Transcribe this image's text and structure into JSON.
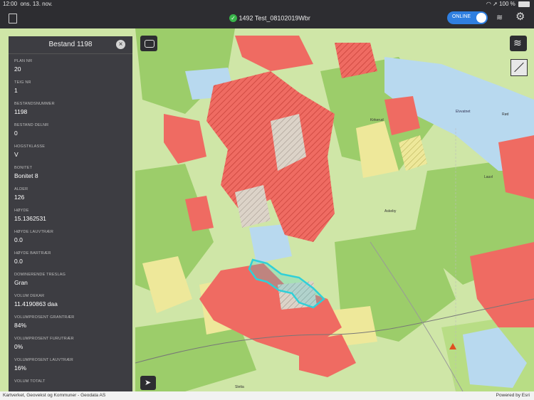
{
  "status_bar": {
    "time": "12:00",
    "date": "ons. 13. nov.",
    "battery": "100 %"
  },
  "top_bar": {
    "project_title": "1492 Test_08102019Wbr",
    "online_label": "ONLINE"
  },
  "panel": {
    "title": "Bestand 1198",
    "fields": [
      {
        "label": "PLAN NR",
        "value": "20"
      },
      {
        "label": "TEIG NR",
        "value": "1"
      },
      {
        "label": "BESTANDSNUMMER",
        "value": "1198"
      },
      {
        "label": "BESTAND DELNR",
        "value": "0"
      },
      {
        "label": "HOGSTKLASSE",
        "value": "V"
      },
      {
        "label": "BONITET",
        "value": "Bonitet 8"
      },
      {
        "label": "ALDER",
        "value": "126"
      },
      {
        "label": "HØYDE",
        "value": "15.1362531"
      },
      {
        "label": "HØYDE LAUVTRÆR",
        "value": "0.0"
      },
      {
        "label": "HØYDE BARTRÆR",
        "value": "0.0"
      },
      {
        "label": "DOMINERENDE TRESLAG",
        "value": "Gran"
      },
      {
        "label": "VOLUM DEKAR",
        "value": "11.4190863 daa"
      },
      {
        "label": "VOLUMPROSENT GRANTRÆR",
        "value": "84%"
      },
      {
        "label": "VOLUMPROSENT FURUTRÆR",
        "value": "0%"
      },
      {
        "label": "VOLUMPROSENT LAUVTRÆR",
        "value": "16%"
      },
      {
        "label": "VOLUM TOTALT",
        "value": ""
      }
    ]
  },
  "map": {
    "place_labels": [
      "Elvvatnet",
      "Askeby",
      "Rød",
      "Sletta",
      "Kirkerud",
      "Lauvl"
    ]
  },
  "footer": {
    "attribution": "Kartverket, Geovekst og Kommuner - Geodata AS",
    "powered_by": "Powered by Esri"
  },
  "colors": {
    "forest_green": "#9ccd6a",
    "light_green": "#cfe6a7",
    "water": "#b8d9ef",
    "stand_red": "#ef6b62",
    "highlight": "#2fd0d8",
    "yellow": "#eee89a"
  }
}
